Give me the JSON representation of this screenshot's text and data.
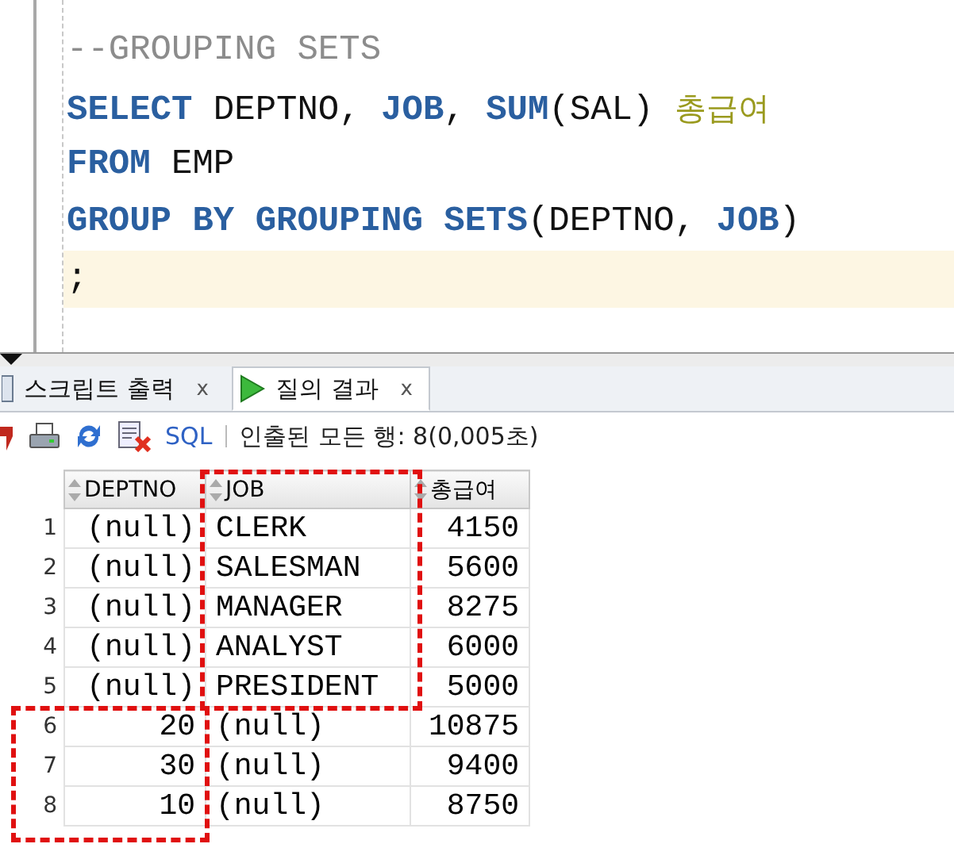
{
  "editor": {
    "lines": [
      {
        "current": false,
        "tokens": [
          {
            "kind": "comment",
            "text": "--GROUPING SETS"
          }
        ]
      },
      {
        "current": false,
        "tokens": [
          {
            "kind": "keyword",
            "text": "SELECT"
          },
          {
            "kind": "plain",
            "text": " DEPTNO, "
          },
          {
            "kind": "keyword",
            "text": "JOB"
          },
          {
            "kind": "plain",
            "text": ", "
          },
          {
            "kind": "keyword",
            "text": "SUM"
          },
          {
            "kind": "plain",
            "text": "(SAL) "
          },
          {
            "kind": "alias",
            "text": "총급여"
          }
        ]
      },
      {
        "current": false,
        "tokens": [
          {
            "kind": "keyword",
            "text": "FROM"
          },
          {
            "kind": "plain",
            "text": " EMP"
          }
        ]
      },
      {
        "current": false,
        "tokens": [
          {
            "kind": "keyword",
            "text": "GROUP BY GROUPING SETS"
          },
          {
            "kind": "plain",
            "text": "(DEPTNO, "
          },
          {
            "kind": "keyword",
            "text": "JOB"
          },
          {
            "kind": "plain",
            "text": ")"
          }
        ]
      },
      {
        "current": true,
        "tokens": [
          {
            "kind": "plain",
            "text": ";"
          }
        ]
      }
    ]
  },
  "tabs": [
    {
      "label": "스크립트 출력",
      "close": "x",
      "selected": false,
      "kind": "script"
    },
    {
      "label": "질의 결과",
      "close": "x",
      "selected": true,
      "kind": "query"
    }
  ],
  "toolbar": {
    "sql_link": "SQL",
    "status": "인출된 모든 행: 8(0,005초)"
  },
  "table": {
    "columns": [
      "DEPTNO",
      "JOB",
      "총급여"
    ],
    "rows": [
      {
        "num": "1",
        "cells": [
          "(null)",
          "CLERK",
          "4150"
        ]
      },
      {
        "num": "2",
        "cells": [
          "(null)",
          "SALESMAN",
          "5600"
        ]
      },
      {
        "num": "3",
        "cells": [
          "(null)",
          "MANAGER",
          "8275"
        ]
      },
      {
        "num": "4",
        "cells": [
          "(null)",
          "ANALYST",
          "6000"
        ]
      },
      {
        "num": "5",
        "cells": [
          "(null)",
          "PRESIDENT",
          "5000"
        ]
      },
      {
        "num": "6",
        "cells": [
          "20",
          "(null)",
          "10875"
        ]
      },
      {
        "num": "7",
        "cells": [
          "30",
          "(null)",
          "9400"
        ]
      },
      {
        "num": "8",
        "cells": [
          "10",
          "(null)",
          "8750"
        ]
      }
    ]
  }
}
